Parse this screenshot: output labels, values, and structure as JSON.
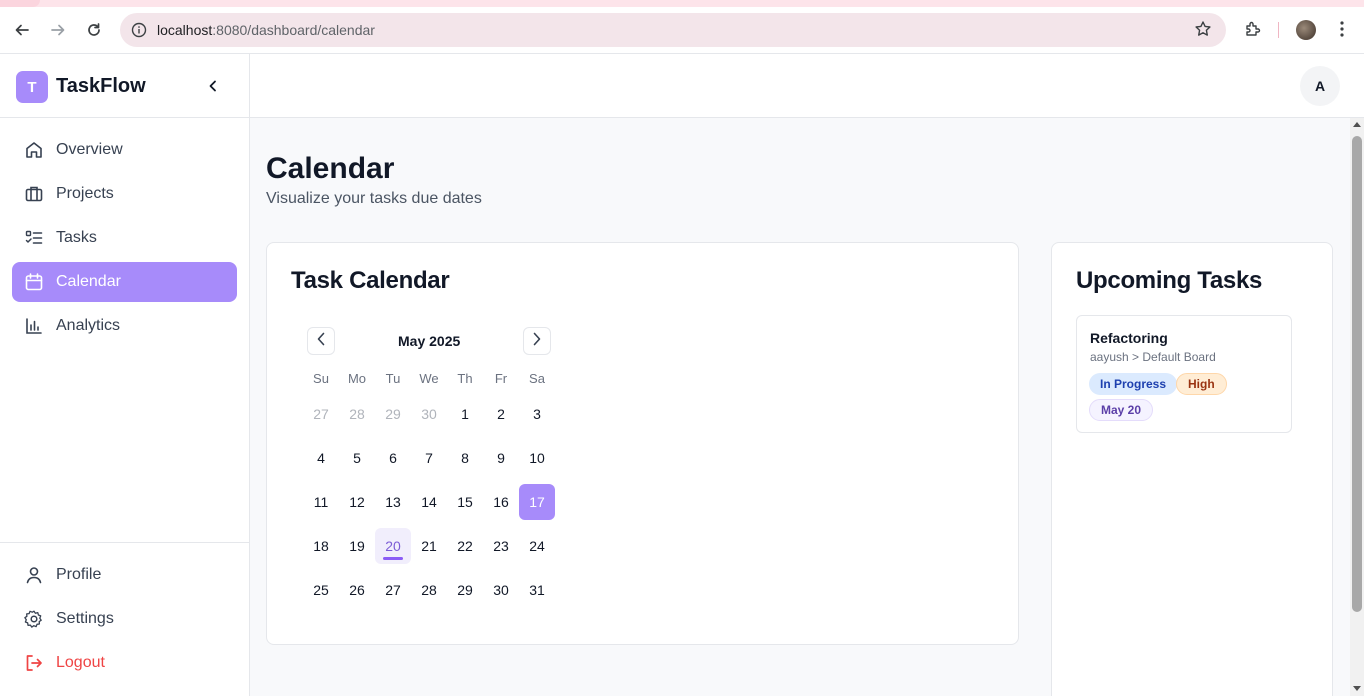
{
  "browser": {
    "url_host": "localhost",
    "url_path": ":8080/dashboard/calendar",
    "icons": [
      "back-icon",
      "forward-icon",
      "reload-icon",
      "info-icon",
      "star-icon",
      "extensions-icon",
      "menu-icon"
    ]
  },
  "brand": {
    "logo_letter": "T",
    "name": "TaskFlow"
  },
  "sidebar": {
    "items": [
      {
        "label": "Overview",
        "icon": "home-icon"
      },
      {
        "label": "Projects",
        "icon": "briefcase-icon"
      },
      {
        "label": "Tasks",
        "icon": "checklist-icon"
      },
      {
        "label": "Calendar",
        "icon": "calendar-icon",
        "active": true
      },
      {
        "label": "Analytics",
        "icon": "bar-chart-icon"
      }
    ],
    "bottom": [
      {
        "label": "Profile",
        "icon": "user-icon"
      },
      {
        "label": "Settings",
        "icon": "gear-icon"
      },
      {
        "label": "Logout",
        "icon": "logout-icon"
      }
    ]
  },
  "header": {
    "avatar_letter": "A"
  },
  "page": {
    "title": "Calendar",
    "subtitle": "Visualize your tasks due dates"
  },
  "calendar": {
    "card_title": "Task Calendar",
    "month_label": "May 2025",
    "weekdays": [
      "Su",
      "Mo",
      "Tu",
      "We",
      "Th",
      "Fr",
      "Sa"
    ],
    "weeks": [
      [
        "27",
        "28",
        "29",
        "30",
        "1",
        "2",
        "3"
      ],
      [
        "4",
        "5",
        "6",
        "7",
        "8",
        "9",
        "10"
      ],
      [
        "11",
        "12",
        "13",
        "14",
        "15",
        "16",
        "17"
      ],
      [
        "18",
        "19",
        "20",
        "21",
        "22",
        "23",
        "24"
      ],
      [
        "25",
        "26",
        "27",
        "28",
        "29",
        "30",
        "31"
      ]
    ],
    "selected_day": "17",
    "task_day": "20"
  },
  "upcoming": {
    "card_title": "Upcoming Tasks",
    "tasks": [
      {
        "title": "Refactoring",
        "path": "aayush > Default Board",
        "status": "In Progress",
        "priority": "High",
        "due": "May 20"
      }
    ]
  },
  "colors": {
    "accent": "#a78bfa",
    "logout": "#ef4444"
  }
}
